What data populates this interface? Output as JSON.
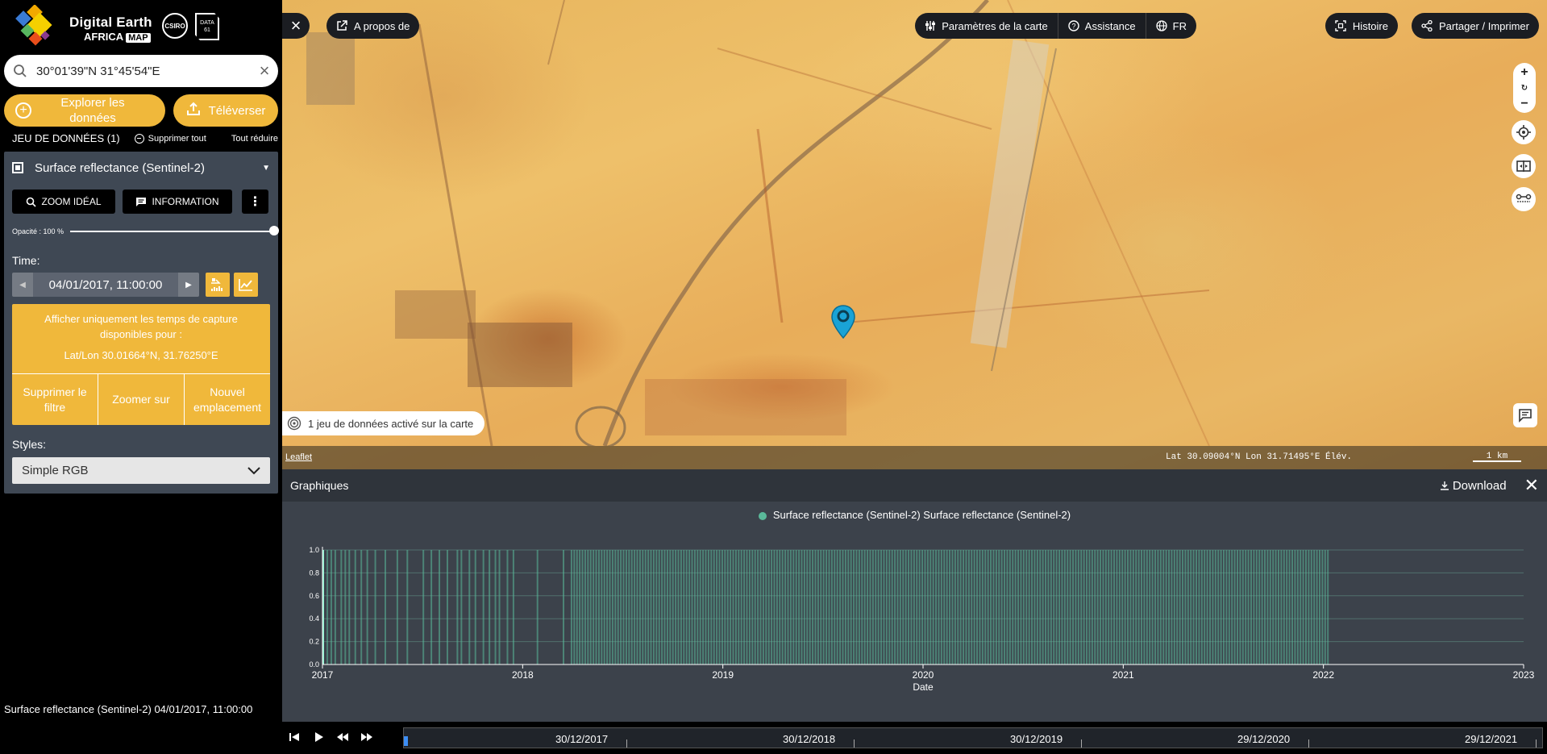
{
  "logo": {
    "title": "Digital Earth",
    "sub": "AFRICA",
    "map": "MAP",
    "csiro": "CSIRO",
    "data61": "DATA 61"
  },
  "search": {
    "value": "30°01'39\"N 31°45'54\"E",
    "clear": "×"
  },
  "explore": {
    "label": "Explorer les données"
  },
  "upload": {
    "label": "Téléverser"
  },
  "datasets": {
    "count_label": "JEU DE DONNÉES (1)",
    "remove_all": "Supprimer tout",
    "collapse_all": "Tout réduire"
  },
  "workbench": {
    "title": "Surface reflectance (Sentinel-2)",
    "zoom_button": "ZOOM IDÉAL",
    "info_button": "INFORMATION",
    "opacity_label": "Opacité : 100 %",
    "opacity_value": 1.0,
    "time_label": "Time:",
    "time_value": "04/01/2017, 11:00:00",
    "filter_text": "Afficher uniquement les temps de capture disponibles pour :",
    "filter_latlon": "Lat/Lon 30.01664°N, 31.76250°E",
    "filter_actions": [
      "Supprimer le filtre",
      "Zoomer sur",
      "Nouvel emplacement"
    ],
    "styles_label": "Styles:",
    "styles_value": "Simple RGB"
  },
  "map": {
    "about": "A propos de",
    "toolbar": [
      "Paramètres de la carte",
      "Assistance",
      "FR"
    ],
    "story": "Histoire",
    "share": "Partager / Imprimer",
    "active_datasets": "1 jeu de données activé sur la carte",
    "leaflet": "Leaflet",
    "coords": "Lat 30.09004°N Lon 31.71495°E Élév.",
    "scale": "1 km"
  },
  "charts": {
    "title": "Graphiques",
    "download": "Download",
    "legend": "Surface reflectance (Sentinel-2) Surface reflectance (Sentinel-2)",
    "xlabel": "Date"
  },
  "chart_data": {
    "type": "bar",
    "series": [
      {
        "name": "Surface reflectance (Sentinel-2) Surface reflectance (Sentinel-2)",
        "color": "#5ab99a"
      }
    ],
    "xlim": [
      2017,
      2023
    ],
    "x_ticks": [
      "2017",
      "2018",
      "2019",
      "2020",
      "2021",
      "2022",
      "2023"
    ],
    "ylim": [
      0,
      1
    ],
    "y_ticks": [
      "0.0",
      "0.2",
      "0.4",
      "0.6",
      "0.8",
      "1.0"
    ],
    "xlabel": "Date",
    "ylabel": "",
    "grid": true,
    "sparse_capture_years": [
      2017.0,
      2017.02,
      2017.04,
      2017.06,
      2017.09,
      2017.11,
      2017.13,
      2017.16,
      2017.19,
      2017.22,
      2017.26,
      2017.31,
      2017.37,
      2017.42,
      2017.5,
      2017.54,
      2017.58,
      2017.62,
      2017.67,
      2017.69,
      2017.73,
      2017.76,
      2017.8,
      2017.83,
      2017.86,
      2017.88,
      2017.92,
      2017.95,
      2018.07,
      2018.2
    ],
    "dense_capture_start": 2018.24,
    "dense_capture_end": 2022.03,
    "dense_capture_interval_days": 5,
    "value": 1.0
  },
  "layer_tag": {
    "name": "Surface reflectance (Sentinel-2)",
    "time": "04/01/2017, 11:00:00"
  },
  "timeline": {
    "labels": [
      "30/12/2017",
      "30/12/2018",
      "30/12/2019",
      "29/12/2020",
      "29/12/2021"
    ]
  }
}
